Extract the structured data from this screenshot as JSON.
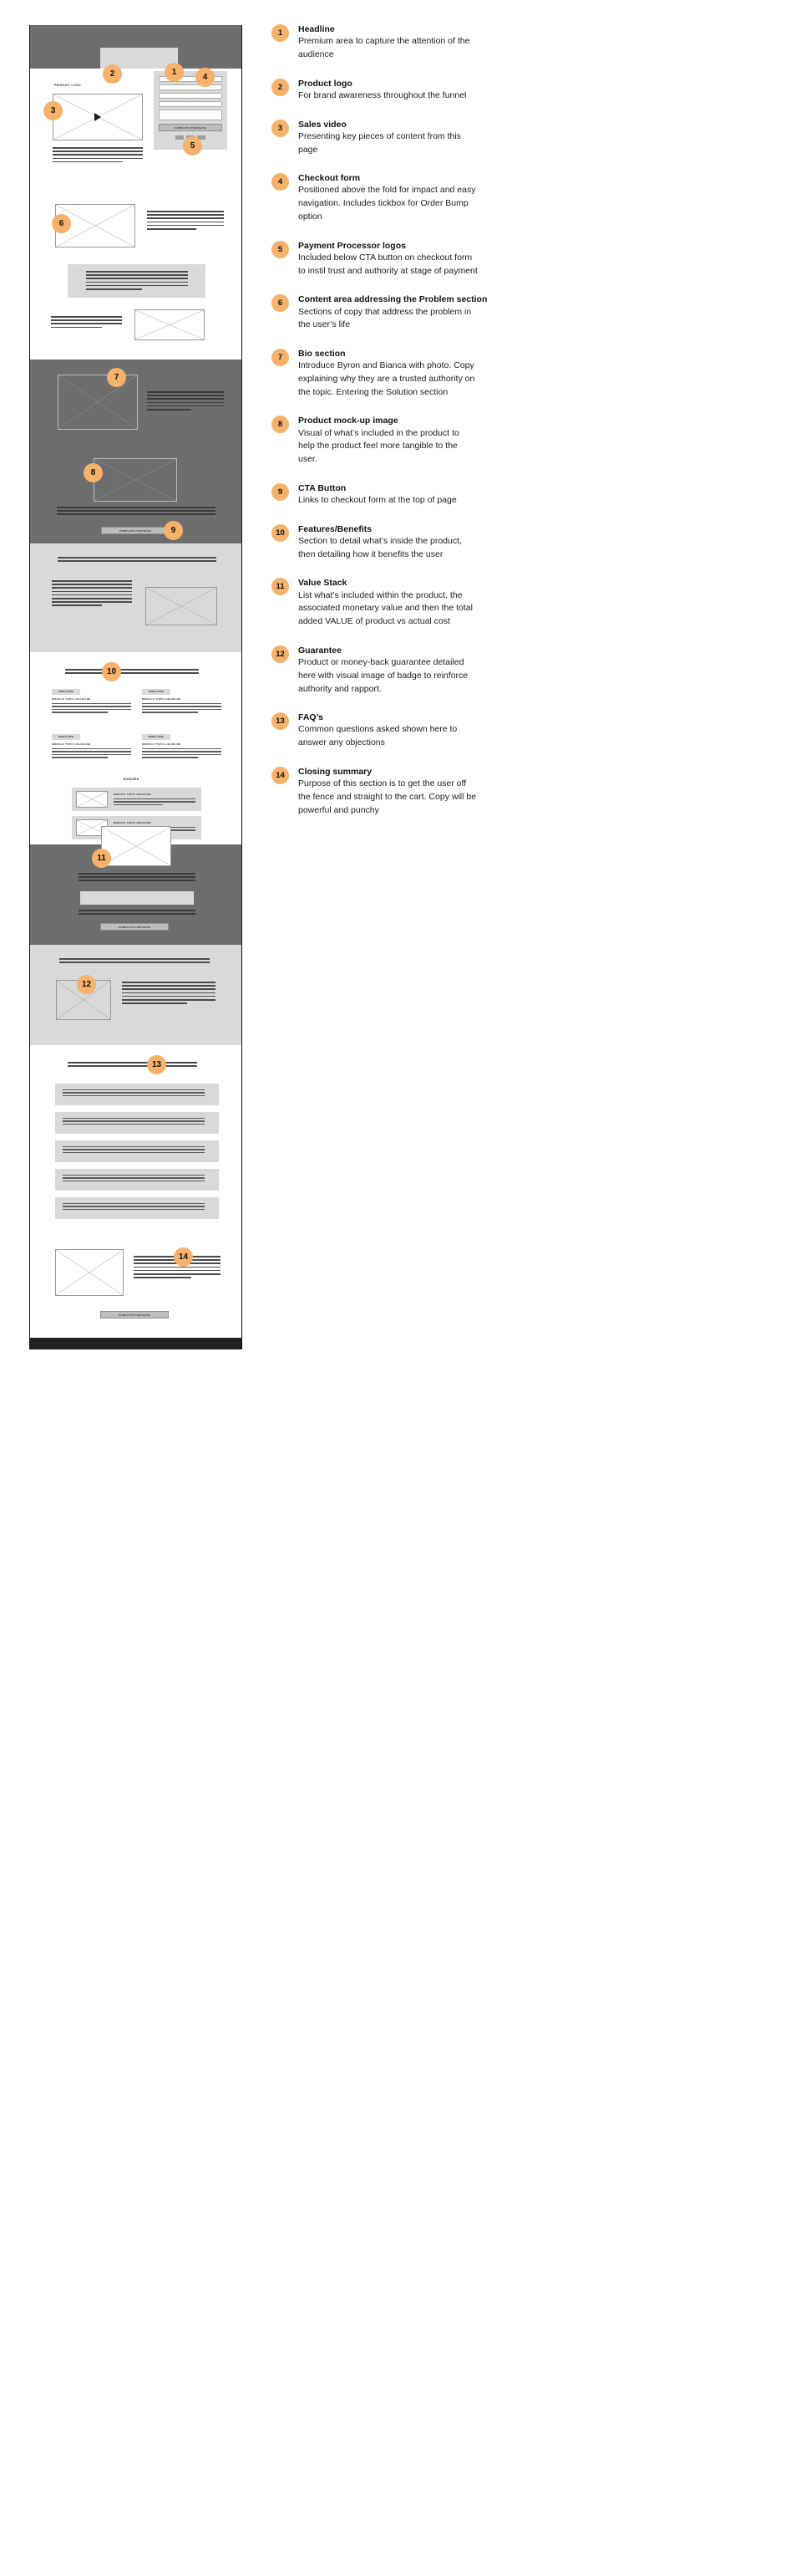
{
  "wireframe": {
    "labels": {
      "product_logo": "PRODUCT LOGO",
      "cta": "COMPLETE PURCHASE",
      "module_topic": "MODULE TOPIC",
      "module_headline": "MODULE TOPIC HEADLINE",
      "bonuses": "BONUSES"
    },
    "markers": [
      "1",
      "2",
      "3",
      "4",
      "5",
      "6",
      "7",
      "8",
      "9",
      "10",
      "11",
      "12",
      "13",
      "14"
    ]
  },
  "legend": {
    "items": [
      {
        "num": "1",
        "title": "Headline",
        "desc": "Premium area to capture the attention of the audience"
      },
      {
        "num": "2",
        "title": "Product logo",
        "desc": "For brand awareness throughout the funnel"
      },
      {
        "num": "3",
        "title": "Sales video",
        "desc": "Presenting key pieces of content from this page"
      },
      {
        "num": "4",
        "title": "Checkout form",
        "desc": "Positioned above the fold for impact and easy navigation. Includes tickbox for Order Bump option"
      },
      {
        "num": "5",
        "title": "Payment Processor logos",
        "desc": "Included below CTA button on checkout form to instil trust and authority at stage of payment"
      },
      {
        "num": "6",
        "title": "Content area addressing the Problem section",
        "desc": "Sections of copy that address the problem in the user’s life"
      },
      {
        "num": "7",
        "title": "Bio section",
        "desc": "Introduce Byron and Bianca with photo. Copy explaining why they are a trusted authority on the topic. Entering the Solution section"
      },
      {
        "num": "8",
        "title": "Product mock-up image",
        "desc": "Visual of what’s included in the product to help the product feel more tangible to the user."
      },
      {
        "num": "9",
        "title": "CTA Button",
        "desc": "Links to checkout form at the top of page"
      },
      {
        "num": "10",
        "title": "Features/Benefits",
        "desc": "Section to detail what’s inside the product, then detailing how it benefits the user"
      },
      {
        "num": "11",
        "title": "Value Stack",
        "desc": "List what’s included within the product, the associated monetary value and then the total added VALUE of product vs actual cost"
      },
      {
        "num": "12",
        "title": "Guarantee",
        "desc": "Product or money-back guarantee detailed here with visual image of badge to reinforce authority and rapport."
      },
      {
        "num": "13",
        "title": "FAQ’s",
        "desc": "Common questions asked shown here to answer any objections"
      },
      {
        "num": "14",
        "title": "Closing summary",
        "desc": "Purpose of this section is to get the user off the fence and straight to the cart. Copy will be powerful and punchy"
      }
    ]
  },
  "colors": {
    "accent": "#f6b26b",
    "dark_band": "#6e6e6e",
    "light_band": "#d9d9d9"
  }
}
